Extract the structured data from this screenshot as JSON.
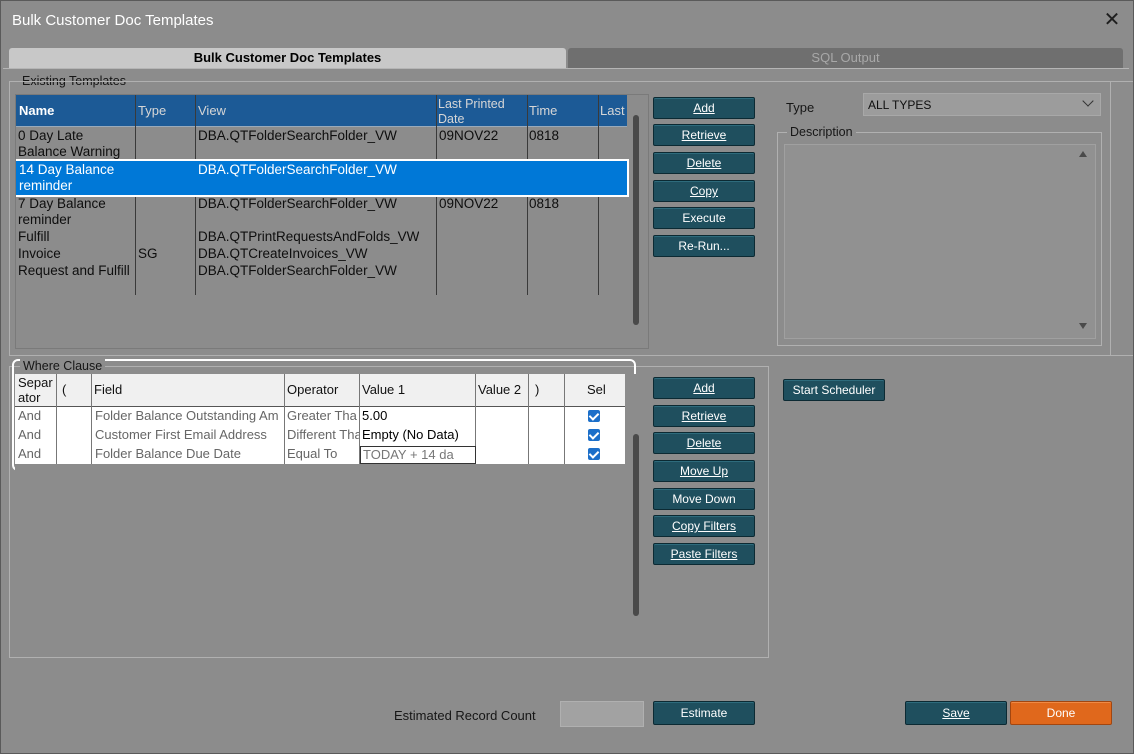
{
  "window": {
    "title": "Bulk Customer Doc Templates",
    "close_glyph": "✕"
  },
  "tabs": [
    {
      "label": "Bulk Customer Doc Templates"
    },
    {
      "label": "SQL Output"
    }
  ],
  "existing_templates": {
    "label": "Existing Templates",
    "headers": [
      "Name",
      "Type",
      "View",
      "Last Printed Date",
      "Time",
      "Last"
    ],
    "rows": [
      {
        "name": "0 Day Late Balance Warning",
        "type": "",
        "view": "DBA.QTFolderSearchFolder_VW",
        "date": "09NOV22",
        "time": "0818"
      },
      {
        "name": "14 Day Balance reminder",
        "type": "",
        "view": "DBA.QTFolderSearchFolder_VW",
        "date": "",
        "time": ""
      },
      {
        "name": "7 Day Balance reminder",
        "type": "",
        "view": "DBA.QTFolderSearchFolder_VW",
        "date": "09NOV22",
        "time": "0818"
      },
      {
        "name": "Fulfill",
        "type": "",
        "view": "DBA.QTPrintRequestsAndFolds_VW",
        "date": "",
        "time": ""
      },
      {
        "name": "Invoice",
        "type": "SG",
        "view": "DBA.QTCreateInvoices_VW",
        "date": "",
        "time": ""
      },
      {
        "name": "Request and Fulfill",
        "type": "",
        "view": "DBA.QTFolderSearchFolder_VW",
        "date": "",
        "time": ""
      }
    ],
    "buttons": [
      "Add",
      "Retrieve",
      "Delete",
      "Copy",
      "Execute",
      "Re-Run..."
    ]
  },
  "type_filter": {
    "label": "Type",
    "value": "ALL TYPES"
  },
  "description": {
    "label": "Description"
  },
  "where_clause": {
    "label": "Where Clause",
    "headers": [
      "Separ ator",
      "(",
      "Field",
      "Operator",
      "Value 1",
      "Value 2",
      ")",
      "Sel"
    ],
    "rows": [
      {
        "sep": "And",
        "field": "Folder Balance Outstanding Am",
        "op": "Greater Tha",
        "v1": "5.00"
      },
      {
        "sep": "And",
        "field": "Customer First Email Address",
        "op": "Different Tha",
        "v1": "Empty (No Data)"
      },
      {
        "sep": "And",
        "field": "Folder Balance Due Date",
        "op": "Equal To",
        "v1": "TODAY + 14 da"
      }
    ],
    "buttons": [
      "Add",
      "Retrieve",
      "Delete",
      "Move Up",
      "Move Down",
      "Copy Filters",
      "Paste Filters"
    ]
  },
  "scheduler_button": "Start Scheduler",
  "footer": {
    "estimated_label": "Estimated Record Count",
    "estimate_button": "Estimate",
    "save_button": "Save",
    "done_button": "Done"
  },
  "colors": {
    "accent": "#0078d7",
    "button": "#1f4f5e",
    "done": "#e0681c",
    "header": "#1c5a96"
  }
}
